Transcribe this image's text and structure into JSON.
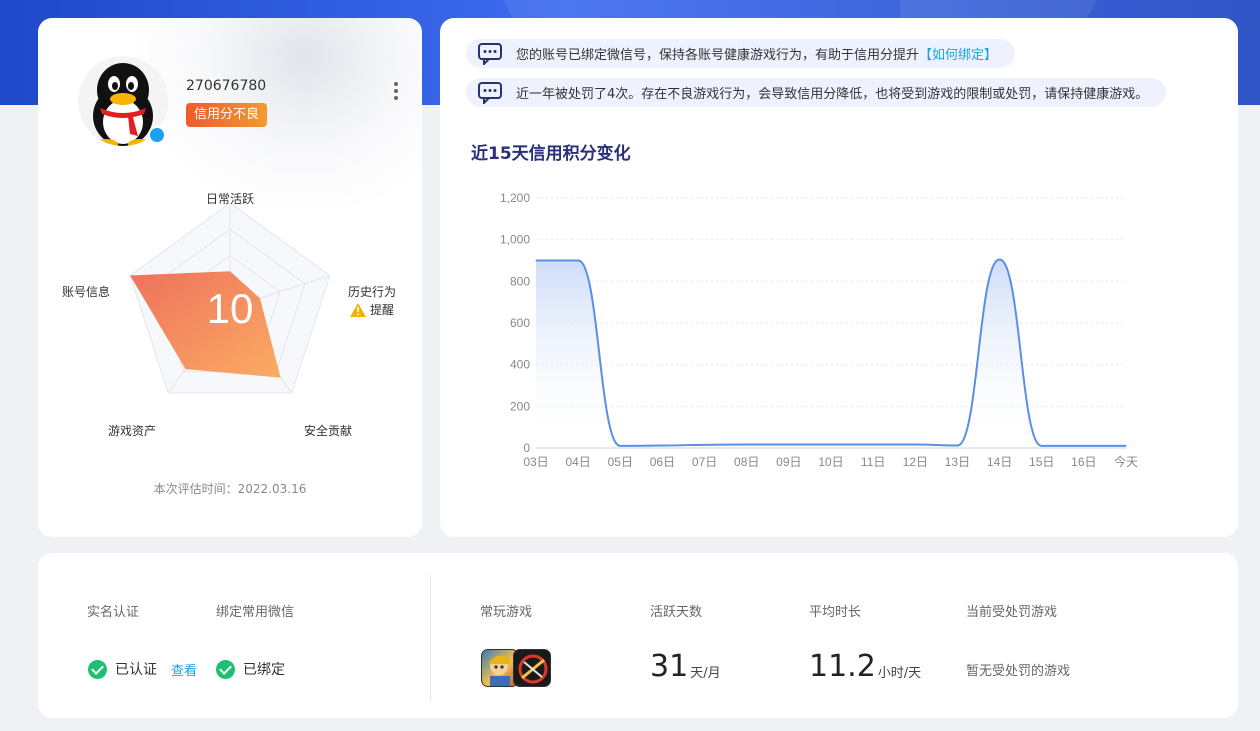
{
  "profile": {
    "uid": "270676780",
    "credit_status": "信用分不良",
    "score": "10",
    "eval_time": "本次评估时间：2022.03.16",
    "radar": {
      "axes": [
        "日常活跃",
        "历史行为",
        "安全贡献",
        "游戏资产",
        "账号信息"
      ],
      "history_warning": "提醒",
      "values": [
        0.35,
        0.3,
        0.82,
        0.72,
        1.0
      ]
    }
  },
  "notices": {
    "bind_text": "您的账号已绑定微信号，保持各账号健康游戏行为，有助于信用分提升",
    "bind_link": "【如何绑定】",
    "penalty_text": "近一年被处罚了4次。存在不良游戏行为，会导致信用分降低，也将受到游戏的限制或处罚，请保持健康游戏。"
  },
  "chart_section": {
    "title": "近15天信用积分变化"
  },
  "chart_data": {
    "type": "area",
    "categories": [
      "03日",
      "04日",
      "05日",
      "06日",
      "07日",
      "08日",
      "09日",
      "10日",
      "11日",
      "12日",
      "13日",
      "14日",
      "15日",
      "16日",
      "今天"
    ],
    "values": [
      900,
      900,
      10,
      12,
      15,
      17,
      17,
      17,
      17,
      17,
      12,
      905,
      10,
      10,
      10
    ],
    "yticks": [
      "0",
      "200",
      "400",
      "600",
      "800",
      "1,000",
      "1,200"
    ],
    "ylim": [
      0,
      1200
    ],
    "grid": true,
    "color": "#5b8fe6"
  },
  "account": {
    "realname_label": "实名认证",
    "wechat_label": "绑定常用微信",
    "realname_value": "已认证",
    "view_link": "查看",
    "wechat_value": "已绑定"
  },
  "stats": {
    "games_label": "常玩游戏",
    "active_days_label": "活跃天数",
    "active_days_value": "31",
    "active_days_unit": "天/月",
    "avg_time_label": "平均时长",
    "avg_time_value": "11.2",
    "avg_time_unit": "小时/天",
    "penalty_game_label": "当前受处罚游戏",
    "penalty_game_value": "暂无受处罚的游戏"
  },
  "colors": {
    "accent_blue": "#1aa3e0",
    "badge_orange": "#f15a2c",
    "success_green": "#1dbf73"
  }
}
